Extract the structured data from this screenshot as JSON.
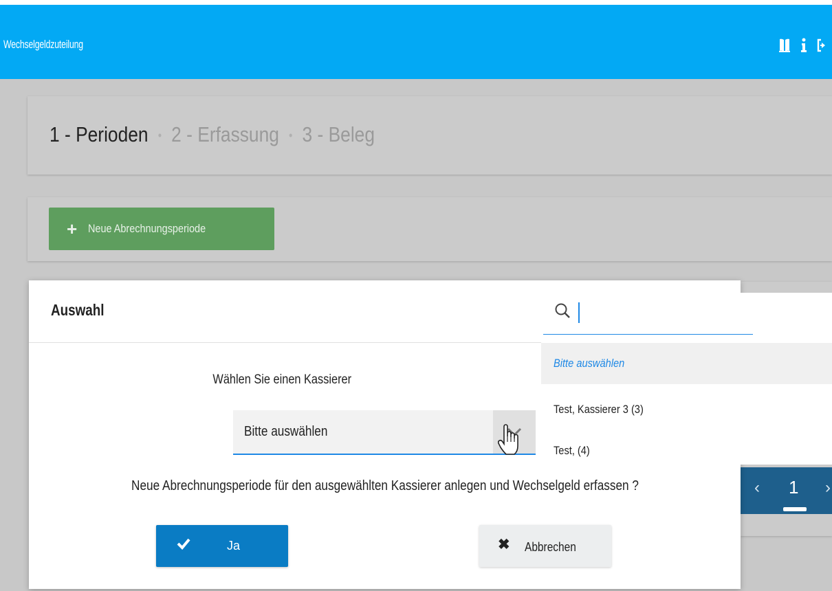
{
  "app": {
    "title": "Wechselgeldzuteilung",
    "icons": [
      "book-icon",
      "info-icon",
      "logout-icon"
    ],
    "brand_color": "#03a9f4"
  },
  "steps": {
    "step1": "1 - Perioden",
    "step2": "2 - Erfassung",
    "step3": "3 - Beleg",
    "separator": "•",
    "active_step": 1
  },
  "toolbar": {
    "new_period_label": "Neue Abrechnungsperiode",
    "new_period_color": "#5e9e5e"
  },
  "pager": {
    "current_page": "1",
    "prev_glyph": "‹",
    "next_glyph": "›"
  },
  "modal": {
    "title": "Auswahl",
    "cashier_prompt": "Wählen Sie einen Kassierer",
    "selected_value": "Bitte auswählen",
    "question": "Neue Abrechnungsperiode für den ausgewählten Kassierer anlegen und Wechselgeld erfassen ?",
    "yes_label": "Ja",
    "cancel_label": "Abbrechen"
  },
  "dropdown": {
    "search_value": "",
    "options": [
      "Bitte auswählen",
      "Test, Kassierer 3 (3)",
      "Test, (4)"
    ],
    "selected_index": 0
  }
}
